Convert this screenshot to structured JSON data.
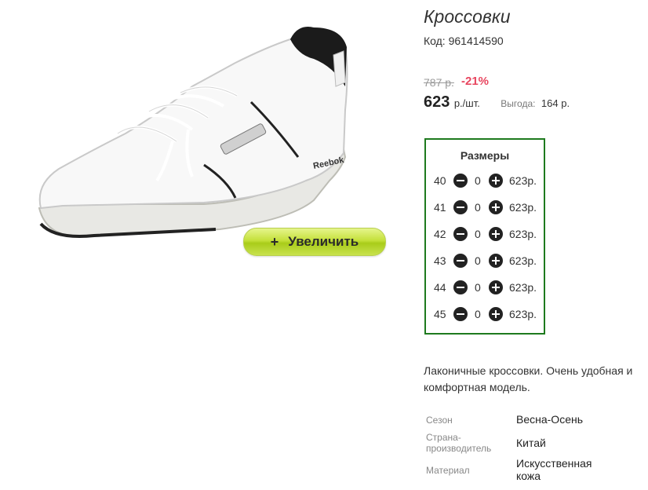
{
  "product": {
    "title": "Кроссовки",
    "code": "Код: 961414590",
    "image_alt": "white-sneaker-photo",
    "zoom_label": "Увеличить",
    "zoom_icon": "+",
    "old_price": "787 р.",
    "discount": "-21%",
    "price": "623",
    "price_unit": "р./шт.",
    "saving_label": "Выгода:",
    "saving_value": "164 р.",
    "description": "Лаконичные кроссовки. Очень удобная и комфортная модель."
  },
  "sizes": {
    "title": "Размеры",
    "rows": [
      {
        "size": "40",
        "qty": "0",
        "price": "623р."
      },
      {
        "size": "41",
        "qty": "0",
        "price": "623р."
      },
      {
        "size": "42",
        "qty": "0",
        "price": "623р."
      },
      {
        "size": "43",
        "qty": "0",
        "price": "623р."
      },
      {
        "size": "44",
        "qty": "0",
        "price": "623р."
      },
      {
        "size": "45",
        "qty": "0",
        "price": "623р."
      }
    ]
  },
  "properties": [
    {
      "label": "Сезон",
      "value": "Весна-Осень"
    },
    {
      "label": "Страна-производитель",
      "label_line1": "Страна-",
      "label_line2": "производитель",
      "value": "Китай"
    },
    {
      "label": "Материал",
      "value": "Искусственная кожа",
      "value_line1": "Искусственная",
      "value_line2": "кожа"
    }
  ],
  "colors": {
    "accent_green_border": "#1e7a1e",
    "discount_red": "#e8465f",
    "zoom_button_green": "#c4e03a"
  }
}
